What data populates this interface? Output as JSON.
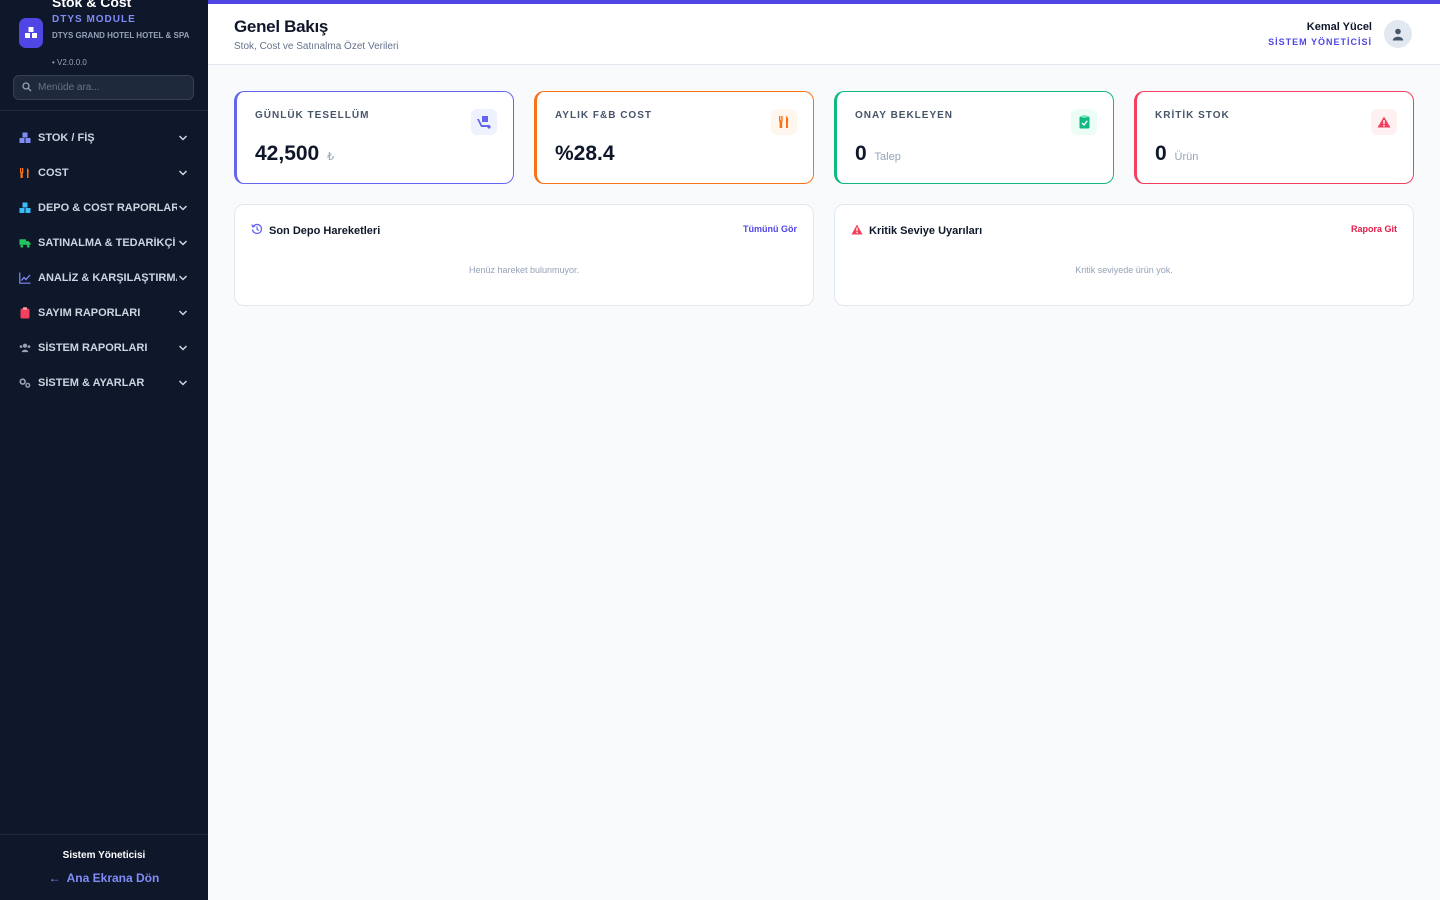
{
  "brand": {
    "title": "Stok & Cost",
    "module": "DTYS MODULE",
    "hotel": "DTYS GRAND HOTEL HOTEL & SPA",
    "version": "• V2.0.0.0"
  },
  "search": {
    "placeholder": "Menüde ara..."
  },
  "nav": {
    "items": [
      {
        "label": "STOK / FİŞ",
        "icon": "boxes-icon",
        "color": "#818cf8"
      },
      {
        "label": "COST",
        "icon": "utensils-icon",
        "color": "#f97316"
      },
      {
        "label": "DEPO & COST RAPORLARI",
        "icon": "warehouse-icon",
        "color": "#38bdf8"
      },
      {
        "label": "SATINALMA & TEDARİKÇİ",
        "icon": "truck-icon",
        "color": "#22c55e"
      },
      {
        "label": "ANALİZ & KARŞILAŞTIRMA",
        "icon": "chart-line-icon",
        "color": "#818cf8"
      },
      {
        "label": "SAYIM RAPORLARI",
        "icon": "clipboard-icon",
        "color": "#f43f5e"
      },
      {
        "label": "SİSTEM RAPORLARI",
        "icon": "users-icon",
        "color": "#94a3b8"
      },
      {
        "label": "SİSTEM & AYARLAR",
        "icon": "gears-icon",
        "color": "#94a3b8"
      }
    ]
  },
  "footer": {
    "role": "Sistem Yöneticisi",
    "back_label": "Ana Ekrana Dön"
  },
  "header": {
    "title": "Genel Bakış",
    "subtitle": "Stok, Cost ve Satınalma Özet Verileri",
    "user_name": "Kemal Yücel",
    "user_role": "SİSTEM YÖNETİCİSİ"
  },
  "cards": [
    {
      "label": "GÜNLÜK TESELLÜM",
      "value": "42,500",
      "unit": "₺",
      "icon": "truck-ramp-icon",
      "color": "#6366f1"
    },
    {
      "label": "AYLIK F&B COST",
      "value": "%28.4",
      "unit": "",
      "icon": "utensils-icon",
      "color": "#f97316"
    },
    {
      "label": "ONAY BEKLEYEN",
      "value": "0",
      "unit": "Talep",
      "icon": "clipboard-check-icon",
      "color": "#10b981"
    },
    {
      "label": "KRİTİK STOK",
      "value": "0",
      "unit": "Ürün",
      "icon": "warning-icon",
      "color": "#f43f5e"
    }
  ],
  "panels": {
    "movements": {
      "title": "Son Depo Hareketleri",
      "link": "Tümünü Gör",
      "empty": "Henüz hareket bulunmuyor.",
      "icon": "history-icon"
    },
    "alerts": {
      "title": "Kritik Seviye Uyarıları",
      "link": "Rapora Git",
      "empty": "Kritik seviyede ürün yok.",
      "icon": "warning-icon"
    }
  }
}
